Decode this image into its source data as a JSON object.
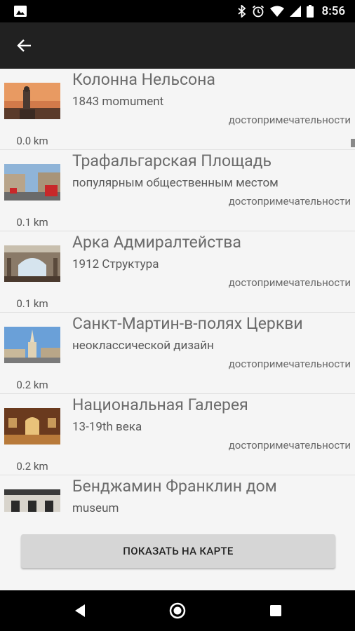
{
  "status_bar": {
    "time": "8:56",
    "icons": [
      "image-icon",
      "bluetooth-icon",
      "alarm-icon",
      "wifi-icon",
      "signal-icon",
      "battery-icon"
    ]
  },
  "toolbar": {
    "back_icon": "arrow-back-icon"
  },
  "places": [
    {
      "title": "Колонна Нельсона",
      "subtitle": "1843 momument",
      "category": "достопримечательности",
      "distance": "0.0 km"
    },
    {
      "title": "Трафальгарская Площадь",
      "subtitle": "популярным общественным местом",
      "category": "достопримечательности",
      "distance": "0.1 km"
    },
    {
      "title": "Арка Адмиралтейства",
      "subtitle": "1912 Структура",
      "category": "достопримечательности",
      "distance": "0.1 km"
    },
    {
      "title": "Санкт-Мартин-в-полях Церкви",
      "subtitle": "неоклассической дизайн",
      "category": "достопримечательности",
      "distance": "0.2 km"
    },
    {
      "title": "Национальная Галерея",
      "subtitle": "13-19th века",
      "category": "достопримечательности",
      "distance": "0.2 km"
    },
    {
      "title": "Бенджамин Франклин дом",
      "subtitle": "museum",
      "category": "",
      "distance": ""
    }
  ],
  "map_button": {
    "label": "ПОКАЗАТЬ НА КАРТЕ"
  },
  "nav_bar": {
    "icons": [
      "nav-back-icon",
      "nav-home-icon",
      "nav-recents-icon"
    ]
  }
}
